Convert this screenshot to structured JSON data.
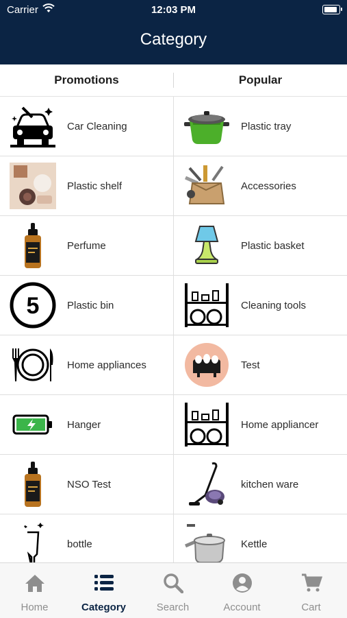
{
  "status": {
    "carrier": "Carrier",
    "time": "12:03 PM"
  },
  "header": {
    "title": "Category"
  },
  "segments": {
    "left": "Promotions",
    "right": "Popular"
  },
  "left_items": [
    {
      "label": "Car Cleaning",
      "icon": "car-cleaning-icon"
    },
    {
      "label": "Plastic shelf",
      "icon": "cosmetics-photo"
    },
    {
      "label": "Perfume",
      "icon": "perfume-bottle-icon"
    },
    {
      "label": "Plastic bin",
      "icon": "number-5-icon"
    },
    {
      "label": "Home appliances",
      "icon": "plate-fork-knife-icon"
    },
    {
      "label": "Hanger",
      "icon": "battery-charging-icon"
    },
    {
      "label": "NSO Test",
      "icon": "perfume-bottle-icon"
    },
    {
      "label": "bottle",
      "icon": "glass-icon"
    }
  ],
  "right_items": [
    {
      "label": "Plastic tray",
      "icon": "cooking-pot-icon"
    },
    {
      "label": "Accessories",
      "icon": "tools-box-icon"
    },
    {
      "label": "Plastic basket",
      "icon": "lamp-icon"
    },
    {
      "label": "Cleaning tools",
      "icon": "dish-rack-icon"
    },
    {
      "label": "Test",
      "icon": "egg-cooker-icon"
    },
    {
      "label": "Home appliancer",
      "icon": "dish-rack-icon"
    },
    {
      "label": "kitchen ware",
      "icon": "vacuum-cleaner-icon"
    },
    {
      "label": "Kettle",
      "icon": "saucepan-icon"
    }
  ],
  "tabs": [
    {
      "label": "Home",
      "icon": "home-icon"
    },
    {
      "label": "Category",
      "icon": "list-icon",
      "active": true
    },
    {
      "label": "Search",
      "icon": "search-icon"
    },
    {
      "label": "Account",
      "icon": "account-icon"
    },
    {
      "label": "Cart",
      "icon": "cart-icon"
    }
  ],
  "colors": {
    "header_bg": "#0b2444",
    "active_tab": "#0b2444",
    "inactive_tab": "#8e8e8e"
  }
}
